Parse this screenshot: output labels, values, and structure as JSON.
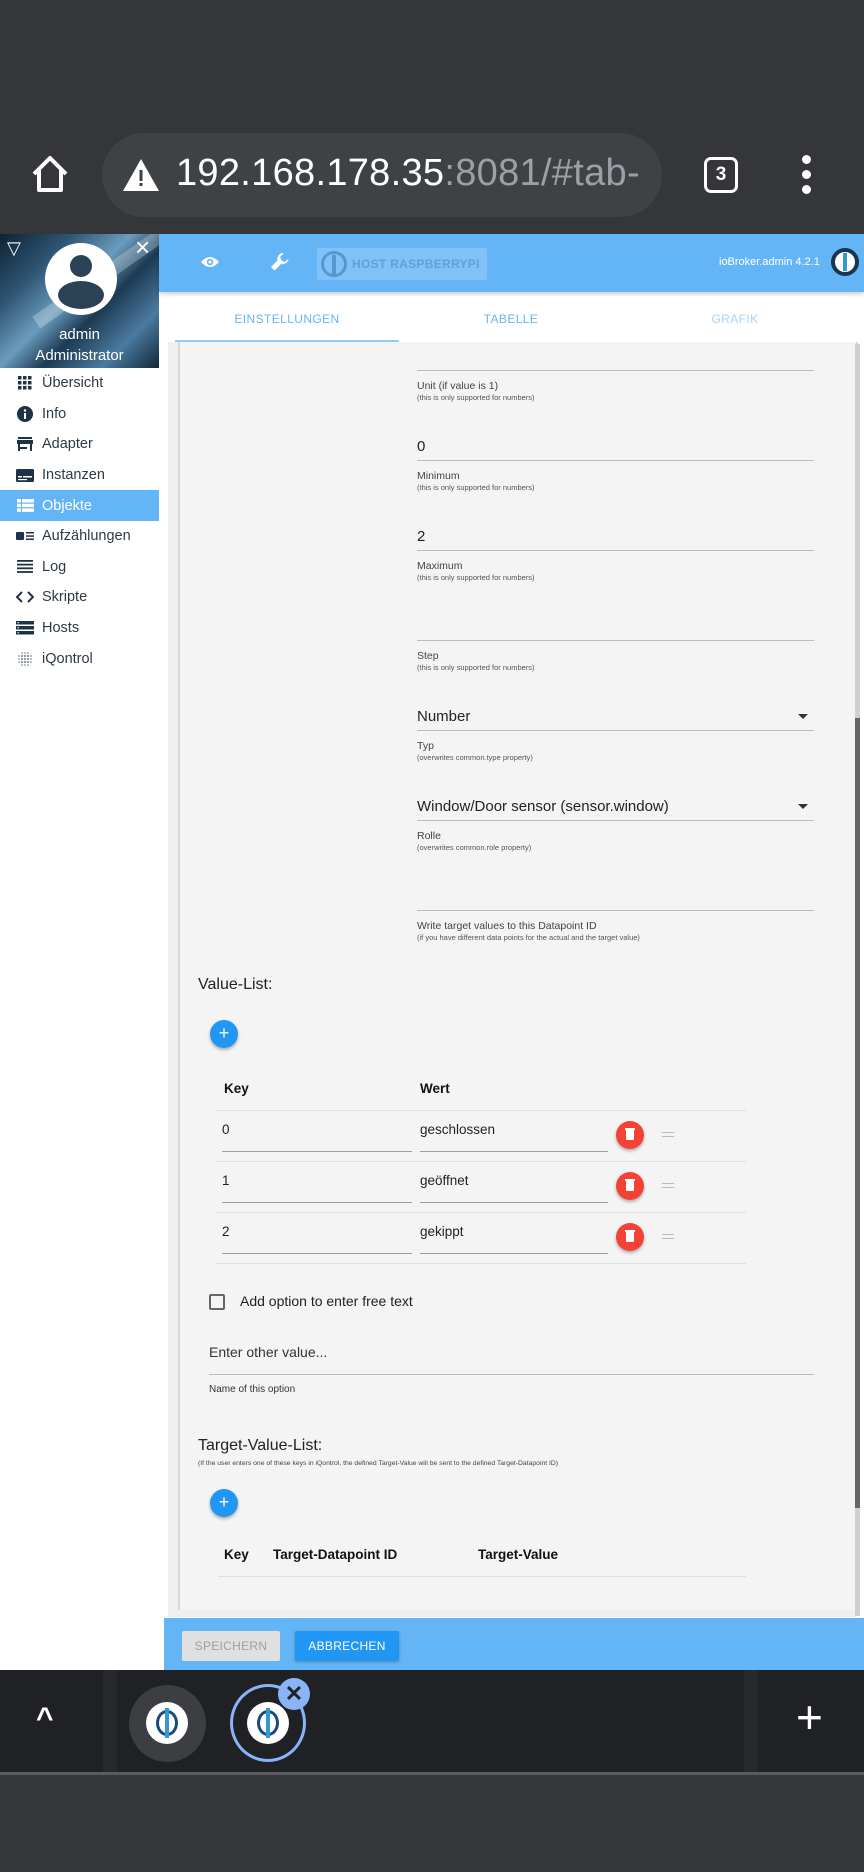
{
  "browser": {
    "url_host": "192.168.178.35",
    "url_rest": ":8081/#tab-",
    "tab_count": "3"
  },
  "sidebar": {
    "user_name": "admin",
    "user_role": "Administrator",
    "items": [
      {
        "label": "Übersicht",
        "icon": "grid-icon"
      },
      {
        "label": "Info",
        "icon": "info-icon"
      },
      {
        "label": "Adapter",
        "icon": "store-icon"
      },
      {
        "label": "Instanzen",
        "icon": "instances-icon"
      },
      {
        "label": "Objekte",
        "icon": "list-icon",
        "active": true
      },
      {
        "label": "Aufzählungen",
        "icon": "enum-icon"
      },
      {
        "label": "Log",
        "icon": "log-icon"
      },
      {
        "label": "Skripte",
        "icon": "code-icon"
      },
      {
        "label": "Hosts",
        "icon": "hosts-icon"
      },
      {
        "label": "iQontrol",
        "icon": "iqontrol-icon"
      }
    ]
  },
  "appbar": {
    "host_label": "HOST RASPBERRYPI",
    "version": "ioBroker.admin 4.2.1"
  },
  "tabs": [
    {
      "label": "EINSTELLUNGEN",
      "state": "active"
    },
    {
      "label": "TABELLE",
      "state": "normal"
    },
    {
      "label": "GRAFIK",
      "state": "disabled"
    }
  ],
  "form": {
    "unit": {
      "value": "",
      "label": "Unit (if value is 1)",
      "hint": "(this is only supported for numbers)"
    },
    "minimum": {
      "value": "0",
      "label": "Minimum",
      "hint": "(this is only supported for numbers)"
    },
    "maximum": {
      "value": "2",
      "label": "Maximum",
      "hint": "(this is only supported for numbers)"
    },
    "step": {
      "value": "",
      "label": "Step",
      "hint": "(this is only supported for numbers)"
    },
    "type": {
      "value": "Number",
      "label": "Typ",
      "hint": "(overwrites common.type property)"
    },
    "role": {
      "value": "Window/Door sensor (sensor.window)",
      "label": "Rolle",
      "hint": "(overwrites common.role property)"
    },
    "target_dp": {
      "value": "",
      "label": "Write target values to this Datapoint ID",
      "hint": "(if you have different data points for the actual and the target value)"
    }
  },
  "value_list": {
    "title": "Value-List:",
    "headers": [
      "Key",
      "Wert"
    ],
    "rows": [
      {
        "key": "0",
        "value": "geschlossen"
      },
      {
        "key": "1",
        "value": "geöffnet"
      },
      {
        "key": "2",
        "value": "gekippt"
      }
    ],
    "free_text_checkbox": {
      "label": "Add option to enter free text",
      "checked": false
    },
    "other_value": {
      "placeholder": "Enter other value...",
      "label": "Name of this option"
    }
  },
  "target_value_list": {
    "title": "Target-Value-List:",
    "hint": "(If the user enters one of these keys in iQontrol, the defined Target-Value will be sent to the defined Target-Datapoint ID)",
    "headers": [
      "Key",
      "Target-Datapoint ID",
      "Target-Value"
    ]
  },
  "actions": {
    "save_label": "SPEICHERN",
    "cancel_label": "ABBRECHEN"
  },
  "colors": {
    "primary": "#64b5f6",
    "accent": "#2196f3",
    "danger": "#f44336"
  }
}
